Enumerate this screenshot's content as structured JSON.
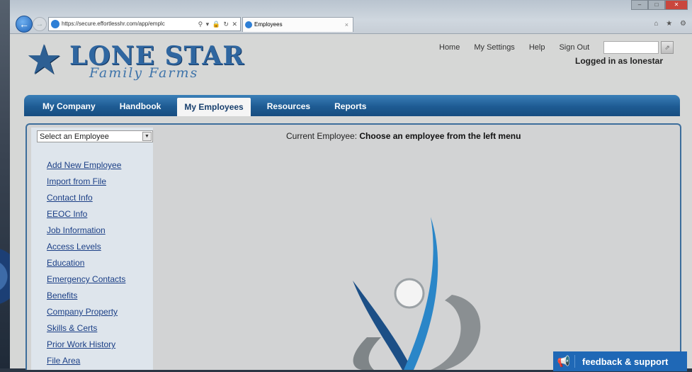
{
  "browser": {
    "url": "https://secure.effortlesshr.com/app/emplc",
    "address_tools": "⚲ ▾ 🔒 ↻ ✕",
    "tab_title": "Employees",
    "tab_close": "×",
    "window_controls": {
      "minimize": "–",
      "maximize": "□",
      "close": "✕"
    },
    "chrome_icons": "⌂ ★ ⚙"
  },
  "logo": {
    "main": "LONE STAR",
    "sub": "Family Farms"
  },
  "header": {
    "links": [
      "Home",
      "My Settings",
      "Help",
      "Sign Out"
    ],
    "search_value": "",
    "logged_in": "Logged in as lonestar"
  },
  "nav": {
    "items": [
      "My Company",
      "Handbook",
      "My Employees",
      "Resources",
      "Reports"
    ],
    "active": "My Employees"
  },
  "sidebar": {
    "select_value": "Select an Employee",
    "items": [
      "Add New Employee",
      "Import from File",
      "Contact Info",
      "EEOC Info",
      "Job Information",
      "Access Levels",
      "Education",
      "Emergency Contacts",
      "Benefits",
      "Company Property",
      "Skills & Certs",
      "Prior Work History",
      "File Area"
    ]
  },
  "main": {
    "current_label": "Current Employee: ",
    "current_value": "Choose an employee from the left menu"
  },
  "feedback": {
    "label": "feedback & support"
  },
  "colors": {
    "nav_blue": "#1e5b93",
    "link": "#1b3f86",
    "feedback": "#1f68b6"
  },
  "icons": {
    "back": "back-arrow-icon",
    "forward": "forward-arrow-icon",
    "star": "star-icon",
    "feedback": "megaphone-icon"
  }
}
